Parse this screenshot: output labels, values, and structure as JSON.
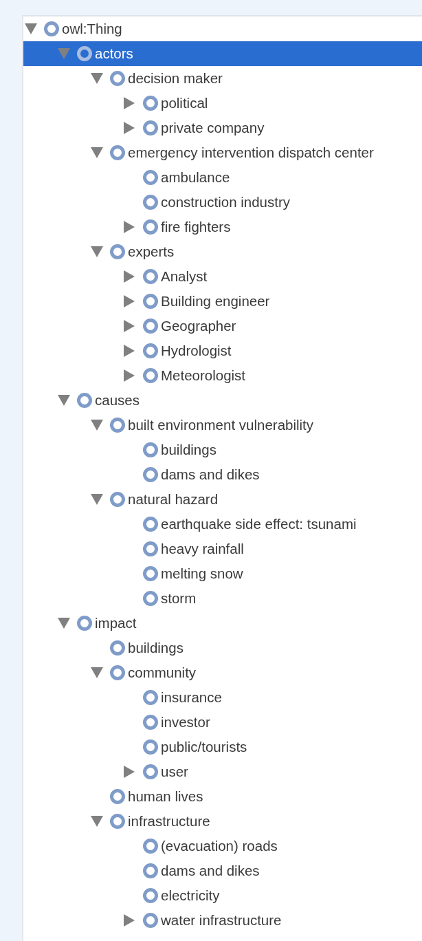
{
  "tree": [
    {
      "label": "owl:Thing",
      "expanded": true,
      "selected": false,
      "children": [
        {
          "label": "actors",
          "expanded": true,
          "selected": true,
          "children": [
            {
              "label": "decision maker",
              "expanded": true,
              "selected": false,
              "children": [
                {
                  "label": "political",
                  "expanded": false,
                  "selected": false
                },
                {
                  "label": "private company",
                  "expanded": false,
                  "selected": false
                }
              ]
            },
            {
              "label": "emergency intervention dispatch center",
              "expanded": true,
              "selected": false,
              "children": [
                {
                  "label": "ambulance",
                  "selected": false
                },
                {
                  "label": "construction industry",
                  "selected": false
                },
                {
                  "label": "fire fighters",
                  "expanded": false,
                  "selected": false
                }
              ]
            },
            {
              "label": "experts",
              "expanded": true,
              "selected": false,
              "children": [
                {
                  "label": "Analyst",
                  "expanded": false,
                  "selected": false
                },
                {
                  "label": "Building engineer",
                  "expanded": false,
                  "selected": false
                },
                {
                  "label": "Geographer",
                  "expanded": false,
                  "selected": false
                },
                {
                  "label": "Hydrologist",
                  "expanded": false,
                  "selected": false
                },
                {
                  "label": "Meteorologist",
                  "expanded": false,
                  "selected": false
                }
              ]
            }
          ]
        },
        {
          "label": "causes",
          "expanded": true,
          "selected": false,
          "children": [
            {
              "label": "built environment vulnerability",
              "expanded": true,
              "selected": false,
              "children": [
                {
                  "label": "buildings",
                  "selected": false
                },
                {
                  "label": "dams and dikes",
                  "selected": false
                }
              ]
            },
            {
              "label": "natural hazard",
              "expanded": true,
              "selected": false,
              "children": [
                {
                  "label": "earthquake side effect: tsunami",
                  "selected": false
                },
                {
                  "label": "heavy rainfall",
                  "selected": false
                },
                {
                  "label": "melting snow",
                  "selected": false
                },
                {
                  "label": "storm",
                  "selected": false
                }
              ]
            }
          ]
        },
        {
          "label": "impact",
          "expanded": true,
          "selected": false,
          "children": [
            {
              "label": "buildings",
              "selected": false
            },
            {
              "label": "community",
              "expanded": true,
              "selected": false,
              "children": [
                {
                  "label": "insurance",
                  "selected": false
                },
                {
                  "label": "investor",
                  "selected": false
                },
                {
                  "label": "public/tourists",
                  "selected": false
                },
                {
                  "label": "user",
                  "expanded": false,
                  "selected": false
                }
              ]
            },
            {
              "label": "human lives",
              "selected": false
            },
            {
              "label": "infrastructure",
              "expanded": true,
              "selected": false,
              "children": [
                {
                  "label": "(evacuation) roads",
                  "selected": false
                },
                {
                  "label": "dams and dikes",
                  "selected": false
                },
                {
                  "label": "electricity",
                  "selected": false
                },
                {
                  "label": "water infrastructure",
                  "expanded": false,
                  "selected": false
                }
              ]
            }
          ]
        }
      ]
    }
  ]
}
